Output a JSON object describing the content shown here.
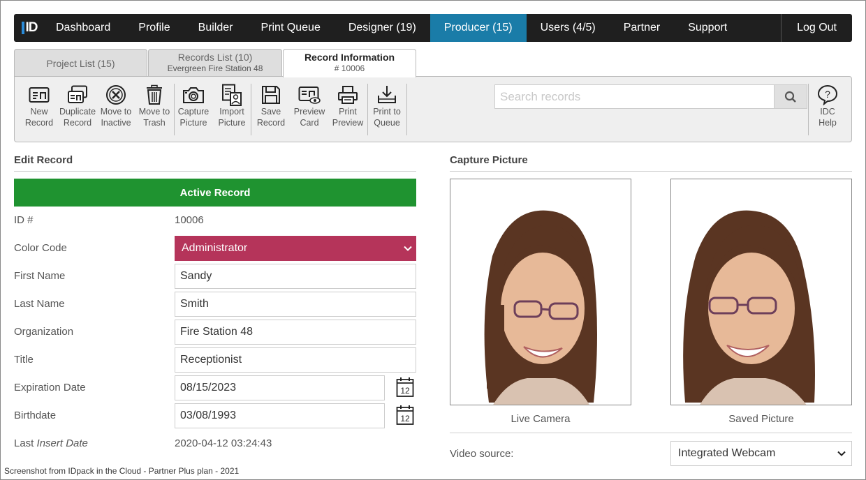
{
  "nav": {
    "logo": "ID",
    "items": [
      "Dashboard",
      "Profile",
      "Builder",
      "Print Queue",
      "Designer (19)",
      "Producer (15)",
      "Users (4/5)",
      "Partner",
      "Support"
    ],
    "logout": "Log Out",
    "active": "Producer (15)"
  },
  "tabs": {
    "project_list": "Project List (15)",
    "records_list": "Records List (10)",
    "records_list_sub": "Evergreen Fire Station 48",
    "record_info": "Record Information",
    "record_info_sub": "# 10006"
  },
  "toolbar": {
    "new_record": [
      "New",
      "Record"
    ],
    "duplicate_record": [
      "Duplicate",
      "Record"
    ],
    "move_inactive": [
      "Move to",
      "Inactive"
    ],
    "move_trash": [
      "Move to",
      "Trash"
    ],
    "capture_picture": [
      "Capture",
      "Picture"
    ],
    "import_picture": [
      "Import",
      "Picture"
    ],
    "save_record": [
      "Save",
      "Record"
    ],
    "preview_card": [
      "Preview",
      "Card"
    ],
    "print_preview": [
      "Print",
      "Preview"
    ],
    "print_queue": [
      "Print to",
      "Queue"
    ],
    "help": [
      "IDC",
      "Help"
    ],
    "search_placeholder": "Search records"
  },
  "edit": {
    "title": "Edit Record",
    "status": "Active Record",
    "fields": {
      "id_label": "ID #",
      "id_value": "10006",
      "color_label": "Color Code",
      "color_value": "Administrator",
      "first_label": "First Name",
      "first_value": "Sandy",
      "last_label": "Last Name",
      "last_value": "Smith",
      "org_label": "Organization",
      "org_value": "Fire Station 48",
      "title_label": "Title",
      "title_value": "Receptionist",
      "exp_label": "Expiration Date",
      "exp_value": "08/15/2023",
      "birth_label": "Birthdate",
      "birth_value": "03/08/1993",
      "insert_label_a": "Last ",
      "insert_label_b": "Insert Date",
      "insert_value": "2020-04-12 03:24:43"
    },
    "calendar_day": "12",
    "color_code_hex": "#b5345a",
    "status_hex": "#1f9330"
  },
  "capture": {
    "title": "Capture Picture",
    "live_caption": "Live Camera",
    "saved_caption": "Saved Picture",
    "video_label": "Video source:",
    "video_value": "Integrated Webcam"
  },
  "footer": "Screenshot from IDpack in the Cloud - Partner Plus plan - 2021"
}
